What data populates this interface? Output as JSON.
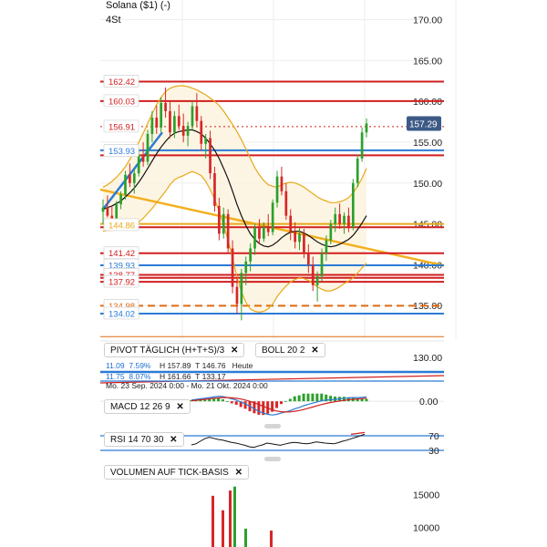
{
  "header": {
    "title": "Solana ($1) (-)",
    "interval": "4St"
  },
  "indicators": {
    "pivot": {
      "label": "PIVOT  TÄGLICH  (H+T+S)/3",
      "close": "✕"
    },
    "boll": {
      "label": "BOLL  20  2",
      "close": "✕"
    },
    "macd": {
      "label": "MACD  12  26  9",
      "close": "✕"
    },
    "rsi": {
      "label": "RSI  14  70  30",
      "close": "✕"
    },
    "volume": {
      "label": "VOLUMEN AUF TICK-BASIS",
      "close": "✕"
    }
  },
  "stats": {
    "row1": {
      "a": "11.09",
      "b": "7.59%",
      "h": "H 157.89",
      "t": "T 146.76",
      "note": "Heute"
    },
    "row2": {
      "a": "11.75",
      "b": "8.07%",
      "h": "H 161.66",
      "t": "T 133.17"
    }
  },
  "date_range": "Mo. 23 Sep. 2024 0:00 - Mo. 21 Okt. 2024 0:00",
  "colors": {
    "up": "#2ca02c",
    "down": "#d62728",
    "pivot_red": "#d11f1f",
    "pivot_blue": "#2b7bd6",
    "boll": "#e7a91a",
    "ma": "#111111",
    "trend": "#f2b01e",
    "current_tag": "#3d5a86"
  },
  "chart_data": [
    {
      "type": "candlestick",
      "title": "Solana ($1) (-)",
      "y_axis_ticks": [
        135,
        140,
        145,
        150,
        155,
        160,
        165,
        170
      ],
      "ylim": [
        130.9,
        172.4
      ],
      "current_price": 157.29,
      "price_labels": [
        {
          "value": 162.42,
          "text": "162.42",
          "color": "#d11f1f"
        },
        {
          "value": 160.03,
          "text": "160.03",
          "color": "#d11f1f"
        },
        {
          "value": 156.91,
          "text": "156.91",
          "color": "#d11f1f"
        },
        {
          "value": 153.93,
          "text": "153.93",
          "color": "#2b7bd6"
        },
        {
          "value": 144.86,
          "text": "144.86",
          "color": "#e7a91a"
        },
        {
          "value": 141.42,
          "text": "141.42",
          "color": "#d11f1f"
        },
        {
          "value": 139.93,
          "text": "139.93",
          "color": "#2b7bd6"
        },
        {
          "value": 138.77,
          "text": "138.77",
          "color": "#d11f1f"
        },
        {
          "value": 137.92,
          "text": "137.92",
          "color": "#d11f1f"
        },
        {
          "value": 134.98,
          "text": "134.98",
          "color": "#e06a10"
        },
        {
          "value": 134.02,
          "text": "134.02",
          "color": "#2b7bd6"
        }
      ],
      "candles": [
        [
          146.5,
          148.0,
          145.0,
          147.0
        ],
        [
          147.0,
          148.5,
          145.8,
          146.0
        ],
        [
          146.0,
          147.2,
          144.9,
          145.5
        ],
        [
          145.5,
          147.8,
          145.2,
          147.4
        ],
        [
          147.4,
          149.0,
          146.8,
          148.6
        ],
        [
          148.6,
          151.5,
          148.0,
          151.0
        ],
        [
          151.0,
          152.4,
          149.5,
          150.0
        ],
        [
          150.0,
          151.8,
          148.7,
          151.2
        ],
        [
          151.2,
          154.0,
          150.8,
          153.5
        ],
        [
          153.5,
          155.0,
          152.0,
          152.6
        ],
        [
          152.6,
          156.5,
          152.2,
          156.0
        ],
        [
          156.0,
          158.8,
          155.0,
          158.0
        ],
        [
          158.0,
          159.5,
          156.0,
          156.8
        ],
        [
          156.8,
          160.5,
          156.2,
          159.8
        ],
        [
          159.8,
          161.7,
          158.0,
          158.8
        ],
        [
          158.8,
          160.0,
          155.5,
          156.2
        ],
        [
          156.2,
          158.8,
          155.5,
          158.2
        ],
        [
          158.2,
          159.6,
          156.5,
          157.0
        ],
        [
          157.0,
          158.5,
          155.0,
          155.8
        ],
        [
          155.8,
          157.5,
          154.5,
          157.0
        ],
        [
          157.0,
          160.0,
          156.5,
          159.4
        ],
        [
          159.4,
          161.0,
          157.0,
          157.6
        ],
        [
          157.6,
          158.2,
          154.0,
          154.8
        ],
        [
          154.8,
          156.0,
          153.0,
          155.5
        ],
        [
          155.5,
          156.4,
          150.5,
          151.2
        ],
        [
          151.2,
          152.0,
          146.5,
          147.2
        ],
        [
          147.2,
          148.2,
          143.0,
          143.8
        ],
        [
          143.8,
          147.0,
          143.2,
          146.2
        ],
        [
          146.2,
          146.8,
          141.5,
          142.0
        ],
        [
          142.0,
          143.0,
          136.5,
          137.3
        ],
        [
          137.3,
          138.5,
          134.0,
          135.2
        ],
        [
          135.2,
          139.5,
          133.2,
          139.0
        ],
        [
          139.0,
          141.0,
          137.5,
          140.4
        ],
        [
          140.4,
          142.6,
          139.2,
          142.0
        ],
        [
          142.0,
          145.0,
          141.2,
          144.5
        ],
        [
          144.5,
          145.6,
          142.5,
          143.2
        ],
        [
          143.2,
          145.2,
          142.8,
          144.6
        ],
        [
          144.6,
          146.2,
          143.5,
          144.0
        ],
        [
          144.0,
          148.0,
          143.6,
          147.6
        ],
        [
          147.6,
          151.5,
          147.0,
          150.8
        ],
        [
          150.8,
          152.0,
          148.5,
          149.0
        ],
        [
          149.0,
          150.0,
          145.5,
          146.0
        ],
        [
          146.0,
          146.8,
          143.0,
          144.0
        ],
        [
          144.0,
          145.2,
          142.0,
          142.8
        ],
        [
          142.8,
          144.5,
          141.8,
          143.8
        ],
        [
          143.8,
          144.4,
          140.8,
          141.5
        ],
        [
          141.5,
          142.5,
          139.0,
          140.0
        ],
        [
          140.0,
          141.0,
          136.8,
          137.5
        ],
        [
          137.5,
          139.2,
          135.5,
          138.6
        ],
        [
          138.6,
          142.0,
          138.0,
          141.4
        ],
        [
          141.4,
          143.6,
          140.5,
          143.0
        ],
        [
          143.0,
          145.5,
          142.5,
          145.0
        ],
        [
          145.0,
          147.0,
          144.0,
          146.2
        ],
        [
          146.2,
          147.5,
          144.4,
          145.0
        ],
        [
          145.0,
          146.4,
          143.8,
          146.0
        ],
        [
          146.0,
          147.0,
          144.0,
          144.6
        ],
        [
          144.6,
          150.5,
          144.2,
          150.0
        ],
        [
          150.0,
          153.5,
          149.5,
          153.0
        ],
        [
          153.0,
          156.8,
          152.6,
          156.2
        ],
        [
          156.2,
          157.9,
          155.6,
          157.29
        ]
      ],
      "ma20": [
        146.8,
        147.0,
        147.2,
        147.5,
        147.8,
        148.3,
        148.8,
        149.4,
        150.1,
        150.9,
        151.8,
        152.7,
        153.6,
        154.4,
        155.1,
        155.7,
        156.1,
        156.3,
        156.4,
        156.5,
        156.5,
        156.3,
        156.0,
        155.5,
        154.8,
        154.0,
        153.0,
        151.8,
        150.5,
        149.0,
        147.4,
        146.0,
        144.8,
        143.8,
        143.1,
        142.6,
        142.3,
        142.2,
        142.4,
        142.8,
        143.3,
        143.7,
        144.0,
        144.1,
        144.1,
        143.9,
        143.6,
        143.2,
        142.8,
        142.5,
        142.3,
        142.2,
        142.3,
        142.5,
        142.8,
        143.1,
        143.6,
        144.3,
        145.1,
        146.0
      ],
      "boll_upper": [
        149.5,
        149.8,
        150.2,
        150.7,
        151.3,
        152.0,
        152.9,
        153.9,
        155.0,
        156.1,
        157.3,
        158.5,
        159.6,
        160.5,
        161.2,
        161.6,
        161.8,
        161.9,
        161.9,
        161.8,
        161.6,
        161.4,
        161.1,
        160.8,
        160.4,
        160.0,
        159.5,
        158.8,
        158.0,
        157.2,
        156.3,
        155.3,
        154.2,
        153.0,
        151.9,
        151.0,
        150.3,
        149.8,
        149.6,
        149.5,
        149.8,
        150.0,
        150.1,
        150.0,
        149.8,
        149.5,
        149.1,
        148.7,
        148.3,
        148.0,
        147.8,
        147.6,
        147.6,
        147.7,
        147.9,
        148.2,
        148.8,
        149.6,
        150.6,
        151.8
      ],
      "boll_lower": [
        144.1,
        144.2,
        144.2,
        144.3,
        144.3,
        144.6,
        144.7,
        144.9,
        145.2,
        145.7,
        146.3,
        146.9,
        147.6,
        148.3,
        149.0,
        149.8,
        150.4,
        150.7,
        150.9,
        151.2,
        151.4,
        151.2,
        150.9,
        150.2,
        149.2,
        148.0,
        146.5,
        144.8,
        143.0,
        140.8,
        138.5,
        136.7,
        135.4,
        134.6,
        134.3,
        134.2,
        134.3,
        134.6,
        135.2,
        136.1,
        136.8,
        137.4,
        137.9,
        138.2,
        138.4,
        138.3,
        138.1,
        137.7,
        137.3,
        137.0,
        136.8,
        136.8,
        137.0,
        137.3,
        137.7,
        138.0,
        138.4,
        139.0,
        139.6,
        140.2
      ],
      "horizontal_lines": [
        {
          "value": 162.42,
          "color": "#d11f1f",
          "style": "solid"
        },
        {
          "value": 160.03,
          "color": "#d11f1f",
          "style": "solid"
        },
        {
          "value": 156.91,
          "color": "#d11f1f",
          "style": "dotted"
        },
        {
          "value": 154.0,
          "color": "#2b7bd6",
          "style": "solid"
        },
        {
          "value": 153.4,
          "color": "#d11f1f",
          "style": "solid"
        },
        {
          "value": 145.0,
          "color": "#e7a91a",
          "style": "solid"
        },
        {
          "value": 144.6,
          "color": "#d11f1f",
          "style": "solid"
        },
        {
          "value": 141.42,
          "color": "#d11f1f",
          "style": "solid"
        },
        {
          "value": 139.93,
          "color": "#2b7bd6",
          "style": "solid"
        },
        {
          "value": 138.77,
          "color": "#d11f1f",
          "style": "solid"
        },
        {
          "value": 138.4,
          "color": "#d11f1f",
          "style": "solid"
        },
        {
          "value": 137.92,
          "color": "#d11f1f",
          "style": "solid"
        },
        {
          "value": 134.98,
          "color": "#e06a10",
          "style": "dashed"
        },
        {
          "value": 134.02,
          "color": "#2b7bd6",
          "style": "solid"
        }
      ]
    },
    {
      "type": "line",
      "title": "MACD 12 26 9",
      "y_axis_ticks": [
        0.0
      ],
      "ylim": [
        -1.6,
        0.6
      ],
      "macd": [
        0.1,
        0.15,
        0.2,
        0.25,
        0.3,
        0.35,
        0.4,
        0.38,
        0.3,
        0.2,
        0.1,
        -0.05,
        -0.2,
        -0.4,
        -0.6,
        -0.8,
        -0.95,
        -1.05,
        -1.1,
        -1.05,
        -0.95,
        -0.85,
        -0.75,
        -0.6,
        -0.5,
        -0.35,
        -0.25,
        -0.15,
        -0.05,
        0.05,
        0.1,
        0.12,
        0.15,
        0.2,
        0.25,
        0.28,
        0.3,
        0.3,
        0.32,
        0.35
      ],
      "signal": [
        0.05,
        0.08,
        0.12,
        0.16,
        0.2,
        0.24,
        0.28,
        0.3,
        0.3,
        0.28,
        0.24,
        0.18,
        0.1,
        0.0,
        -0.12,
        -0.26,
        -0.4,
        -0.55,
        -0.68,
        -0.78,
        -0.84,
        -0.86,
        -0.85,
        -0.8,
        -0.74,
        -0.66,
        -0.56,
        -0.46,
        -0.36,
        -0.26,
        -0.17,
        -0.1,
        -0.04,
        0.02,
        0.07,
        0.12,
        0.16,
        0.19,
        0.22,
        0.25
      ]
    },
    {
      "type": "line",
      "title": "RSI 14 70 30",
      "y_axis_ticks": [
        70,
        30
      ],
      "ylim": [
        20,
        80
      ],
      "rsi": [
        45,
        48,
        55,
        62,
        66,
        63,
        60,
        58,
        55,
        52,
        50,
        47,
        44,
        40,
        38,
        42,
        45,
        50,
        48,
        46,
        44,
        47,
        50,
        52,
        51,
        49,
        48,
        50,
        53,
        52,
        50,
        49,
        48,
        51,
        55,
        58,
        62,
        66,
        70,
        74
      ]
    },
    {
      "type": "bar",
      "title": "VOLUMEN AUF TICK-BASIS",
      "y_axis_ticks": [
        15000,
        10000
      ],
      "ylim": [
        7000,
        17000
      ],
      "bars": [
        {
          "value": 14800,
          "dir": "down"
        },
        {
          "value": 12600,
          "dir": "down"
        },
        {
          "value": 15600,
          "dir": "down"
        },
        {
          "value": 16200,
          "dir": "up"
        },
        {
          "value": 9800,
          "dir": "up"
        },
        {
          "value": 9500,
          "dir": "down"
        }
      ]
    }
  ]
}
